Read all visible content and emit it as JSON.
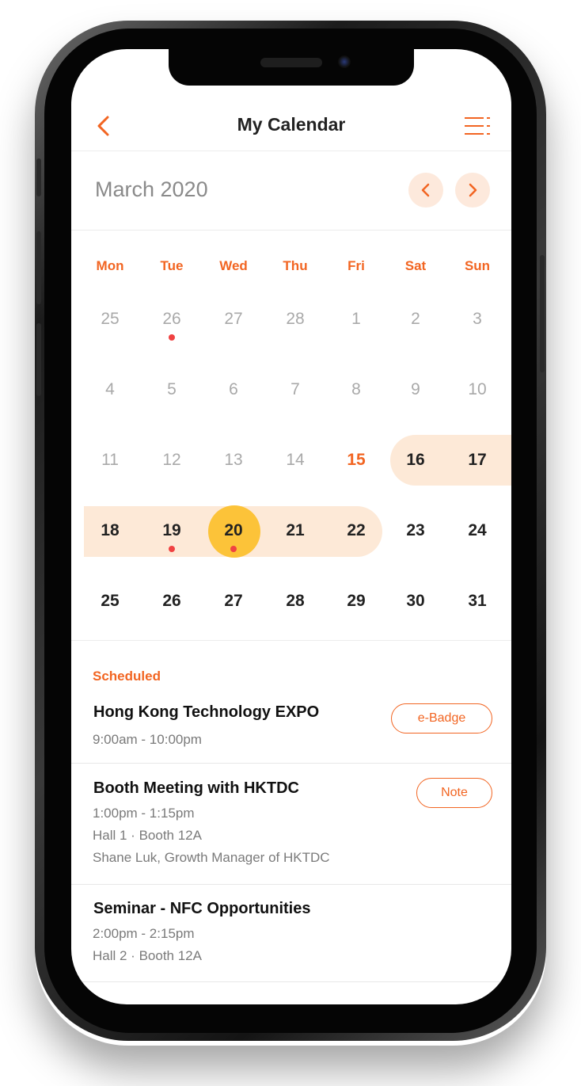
{
  "header": {
    "title": "My Calendar"
  },
  "calendar": {
    "month_label": "March 2020",
    "weekdays": [
      "Mon",
      "Tue",
      "Wed",
      "Thu",
      "Fri",
      "Sat",
      "Sun"
    ],
    "weeks": [
      [
        "25",
        "26",
        "27",
        "28",
        "1",
        "2",
        "3"
      ],
      [
        "4",
        "5",
        "6",
        "7",
        "8",
        "9",
        "10"
      ],
      [
        "11",
        "12",
        "13",
        "14",
        "15",
        "16",
        "17"
      ],
      [
        "18",
        "19",
        "20",
        "21",
        "22",
        "23",
        "24"
      ],
      [
        "25",
        "26",
        "27",
        "28",
        "29",
        "30",
        "31"
      ]
    ],
    "today": "20",
    "highlighted_day": "15"
  },
  "scheduled": {
    "section_title": "Scheduled",
    "events": [
      {
        "title": "Hong Kong Technology EXPO",
        "time": "9:00am - 10:00pm",
        "button": "e-Badge"
      },
      {
        "title": "Booth Meeting with HKTDC",
        "time": "1:00pm - 1:15pm",
        "location": "Hall 1 · Booth 12A",
        "people": "Shane Luk, Growth Manager of HKTDC",
        "button": "Note"
      },
      {
        "title": "Seminar - NFC Opportunities",
        "time": "2:00pm - 2:15pm",
        "location": "Hall 2 · Booth 12A"
      }
    ]
  },
  "colors": {
    "accent": "#f26522",
    "range_fill": "#fde9d7",
    "today_fill": "#fcc339",
    "event_dot": "#f04242"
  }
}
